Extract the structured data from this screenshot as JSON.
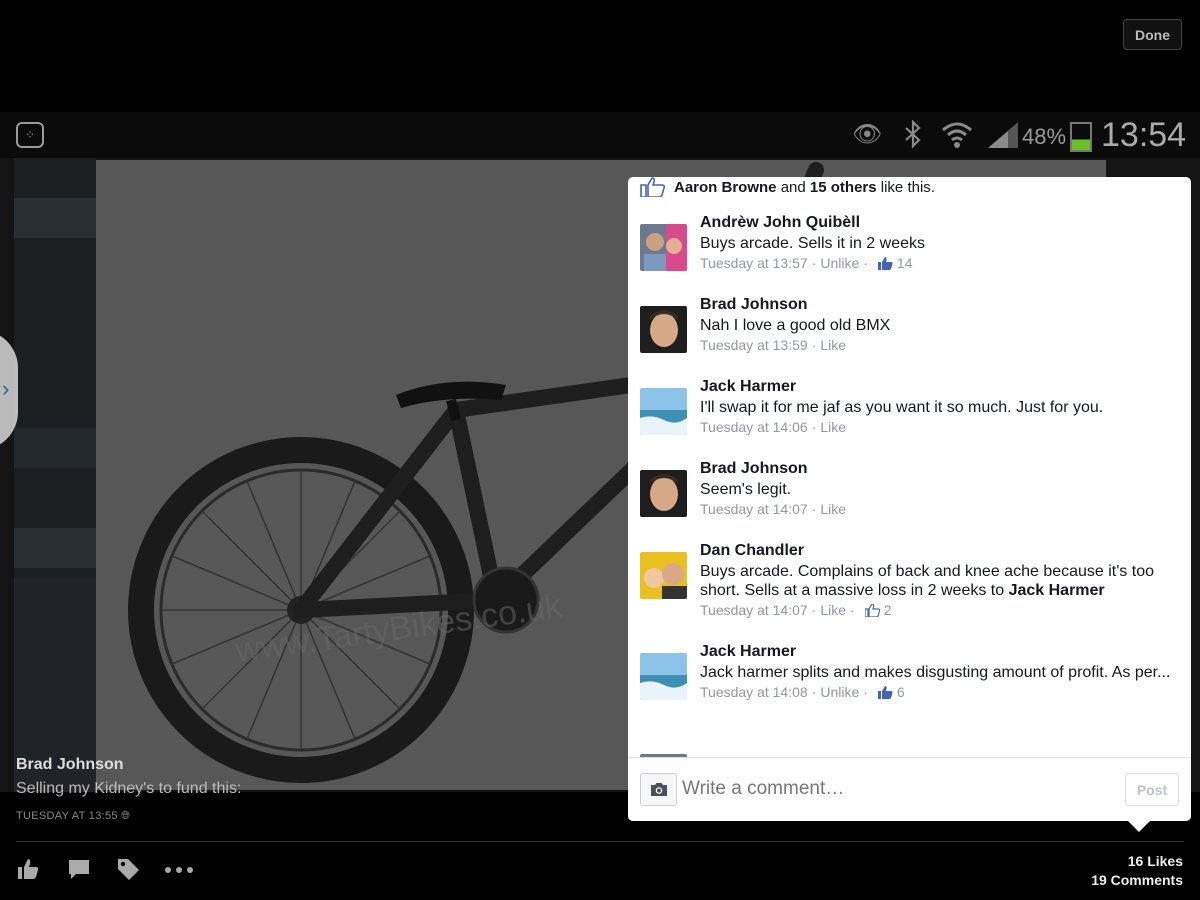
{
  "top_bar": {
    "done_label": "Done"
  },
  "status_bar": {
    "battery": "48%",
    "time": "13:54"
  },
  "caption": {
    "author": "Brad Johnson",
    "text": "Selling my Kidney's to fund this:",
    "timestamp": "TUESDAY AT 13:55"
  },
  "footer": {
    "likes": "16 Likes",
    "comments": "19 Comments"
  },
  "likes_summary": {
    "first": "Aaron Browne",
    "and": "and",
    "others": "15 others",
    "suffix": "like this."
  },
  "comments": [
    {
      "name": "Andrèw John Quibèll",
      "text": "Buys arcade. Sells it in 2 weeks",
      "time": "Tuesday at 13:57",
      "action": "Unlike",
      "likes": "14"
    },
    {
      "name": "Brad Johnson",
      "text": "Nah I love a good old BMX",
      "time": "Tuesday at 13:59",
      "action": "Like",
      "likes": ""
    },
    {
      "name": "Jack Harmer",
      "text": "I'll swap it for me jaf as you want it so much. Just for you.",
      "time": "Tuesday at 14:06",
      "action": "Like",
      "likes": ""
    },
    {
      "name": "Brad Johnson",
      "text": "Seem's legit.",
      "time": "Tuesday at 14:07",
      "action": "Like",
      "likes": ""
    },
    {
      "name": "Dan Chandler",
      "text": "Buys arcade. Complains of back and knee ache because it's too short. Sells at a massive loss in 2 weeks to",
      "mention": "Jack Harmer",
      "time": "Tuesday at 14:07",
      "action": "Like",
      "likes": "2"
    },
    {
      "name": "Jack Harmer",
      "text": "Jack harmer splits and makes disgusting amount of profit. As per...",
      "time": "Tuesday at 14:08",
      "action": "Unlike",
      "likes": "6"
    }
  ],
  "compose": {
    "placeholder": "Write a comment…",
    "post_label": "Post"
  },
  "icons": {
    "bbm": "bbm-icon",
    "eye": "eye-icon",
    "bluetooth": "bluetooth-icon",
    "wifi": "wifi-icon",
    "signal": "signal-icon",
    "battery": "battery-icon",
    "like": "like-icon",
    "comment": "comment-icon",
    "tag": "tag-icon",
    "more": "more-icon",
    "camera": "camera-icon",
    "thumb": "thumb-up-icon"
  },
  "colors": {
    "link_blue": "#4267b2",
    "meta_grey": "#9197a3",
    "battery_green": "#6bbf2a"
  }
}
